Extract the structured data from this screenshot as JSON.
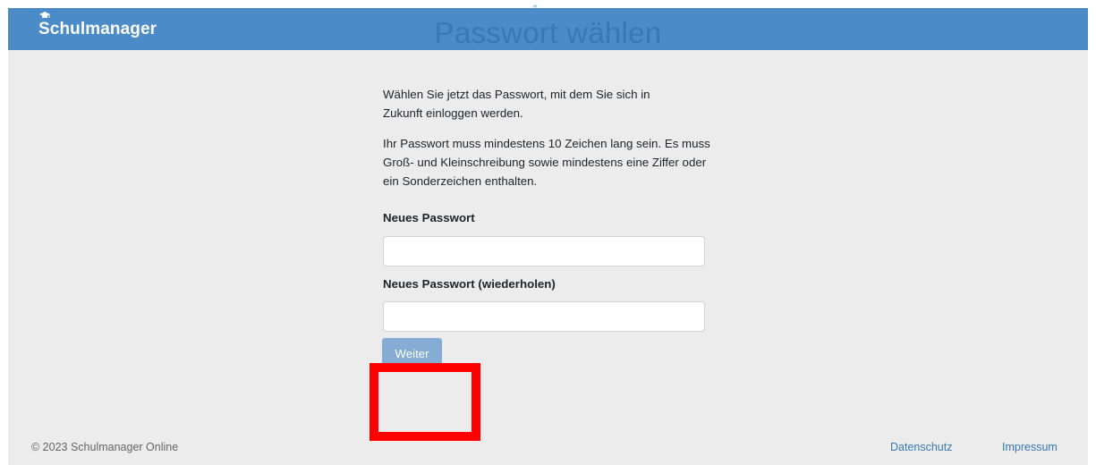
{
  "top_mark": "„",
  "navbar": {
    "brand": "Schulmanager",
    "logo_icon": "graduation-cap-icon",
    "color": "#4a8bc8"
  },
  "main": {
    "title": "Passwort wählen",
    "intro": "Wählen Sie jetzt das Passwort, mit dem Sie sich in Zukunft einloggen werden.",
    "rules": "Ihr Passwort muss mindestens 10 Zeichen lang sein. Es muss Groß- und Kleinschreibung sowie mindestens eine Ziffer oder ein Sonderzeichen enthalten.",
    "new_password_label": "Neues Passwort",
    "new_password_value": "",
    "repeat_password_label": "Neues Passwort (wiederholen)",
    "repeat_password_value": "",
    "submit_label": "Weiter"
  },
  "annotation": {
    "highlight_color": "#ff0000"
  },
  "footer": {
    "copyright": "© 2023 Schulmanager Online",
    "links": [
      "Datenschutz",
      "Impressum"
    ]
  },
  "colors": {
    "accent": "#3679b5",
    "button": "#85acd4",
    "background": "#ececec"
  }
}
